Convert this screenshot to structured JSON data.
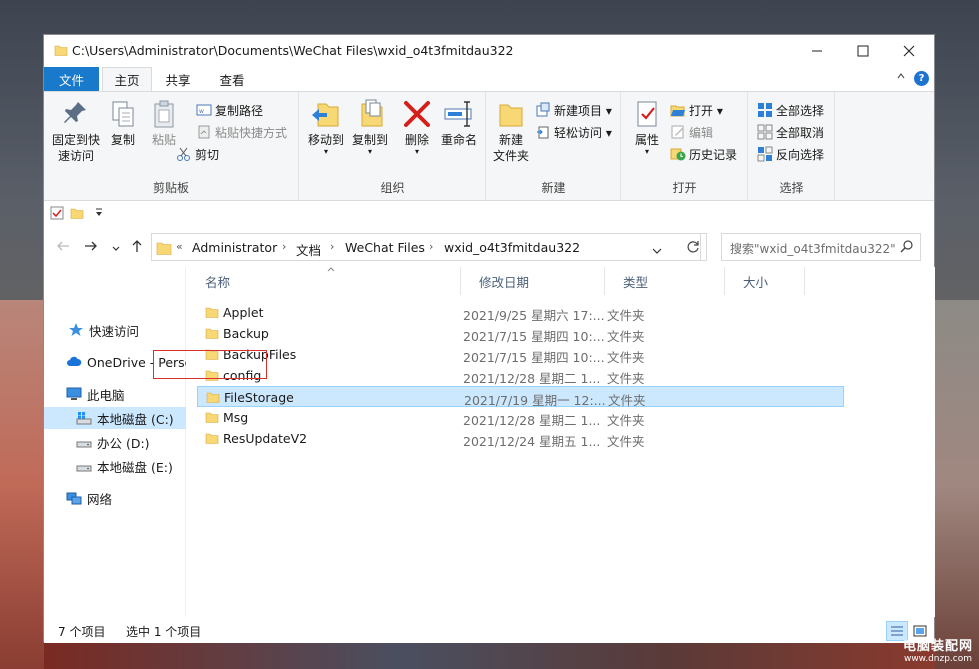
{
  "window": {
    "title": "C:\\Users\\Administrator\\Documents\\WeChat Files\\wxid_o4t3fmitdau322",
    "minimize": "—",
    "maximize": "☐",
    "close": "✕"
  },
  "tabs": {
    "file": "文件",
    "home": "主页",
    "share": "共享",
    "view": "查看"
  },
  "ribbon": {
    "clipboard": {
      "label": "剪贴板",
      "pin_line1": "固定到快",
      "pin_line2": "速访问",
      "copy": "复制",
      "paste": "粘贴",
      "copy_path": "复制路径",
      "paste_shortcut": "粘贴快捷方式",
      "cut": "剪切"
    },
    "organize": {
      "label": "组织",
      "move_to": "移动到",
      "copy_to": "复制到",
      "delete": "删除",
      "rename": "重命名"
    },
    "new": {
      "label": "新建",
      "new_folder_line1": "新建",
      "new_folder_line2": "文件夹",
      "new_item": "新建项目 ▾",
      "easy_access": "轻松访问 ▾"
    },
    "open": {
      "label": "打开",
      "properties": "属性",
      "open": "打开 ▾",
      "edit": "编辑",
      "history": "历史记录"
    },
    "select": {
      "label": "选择",
      "select_all": "全部选择",
      "select_none": "全部取消",
      "invert": "反向选择"
    }
  },
  "address": {
    "crumbs": [
      "Administrator",
      "文档",
      "WeChat Files",
      "wxid_o4t3fmitdau322"
    ],
    "search_placeholder": "搜索\"wxid_o4t3fmitdau322\""
  },
  "nav": {
    "quick_access": "快速访问",
    "onedrive": "OneDrive - Perso",
    "this_pc": "此电脑",
    "drive_c": "本地磁盘 (C:)",
    "drive_d": "办公 (D:)",
    "drive_e": "本地磁盘 (E:)",
    "network": "网络"
  },
  "columns": {
    "name": "名称",
    "date": "修改日期",
    "type": "类型",
    "size": "大小"
  },
  "files": [
    {
      "name": "Applet",
      "date": "2021/9/25 星期六 17:...",
      "type": "文件夹"
    },
    {
      "name": "Backup",
      "date": "2021/7/15 星期四 10:...",
      "type": "文件夹"
    },
    {
      "name": "BackupFiles",
      "date": "2021/7/15 星期四 10:...",
      "type": "文件夹"
    },
    {
      "name": "config",
      "date": "2021/12/28 星期二 1...",
      "type": "文件夹"
    },
    {
      "name": "FileStorage",
      "date": "2021/7/19 星期一 12:...",
      "type": "文件夹"
    },
    {
      "name": "Msg",
      "date": "2021/12/28 星期二 1...",
      "type": "文件夹"
    },
    {
      "name": "ResUpdateV2",
      "date": "2021/12/24 星期五 1...",
      "type": "文件夹"
    }
  ],
  "status": {
    "count": "7 个项目",
    "selected": "选中 1 个项目"
  },
  "watermark": {
    "line1": "电脑装配网",
    "line2": "www.dnzp.com"
  },
  "colors": {
    "accent": "#1979ca",
    "selection": "#cce8ff",
    "highlight_box": "#d9302c",
    "folder": "#f8d775"
  }
}
